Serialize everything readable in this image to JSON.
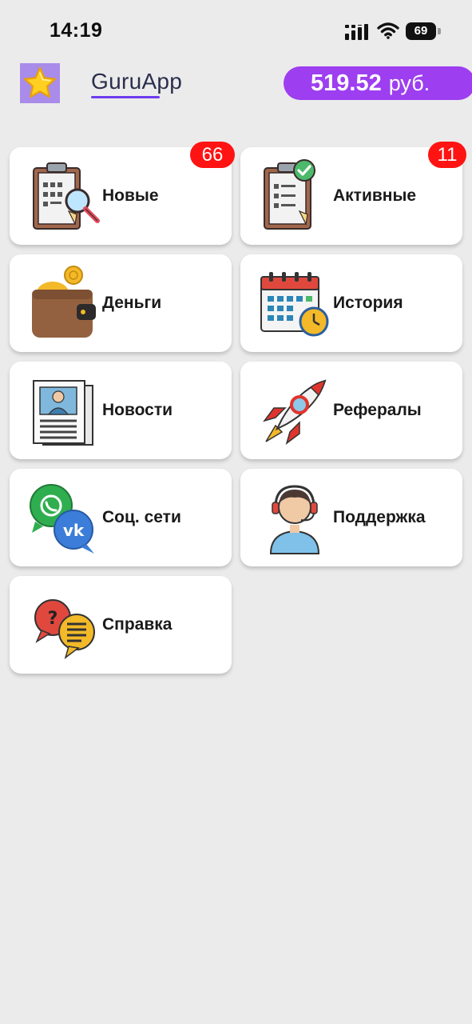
{
  "status_bar": {
    "time": "14:19",
    "battery": "69"
  },
  "header": {
    "title": "GuruApp",
    "balance_amount": "519.52",
    "balance_currency": "руб."
  },
  "colors": {
    "accent": "#9d3ef0",
    "badge": "#ff1313",
    "logo_bg": "#a98be9"
  },
  "tiles": [
    {
      "label": "Новые",
      "icon": "clipboard-search-icon",
      "badge": "66"
    },
    {
      "label": "Активные",
      "icon": "clipboard-check-icon",
      "badge": "11"
    },
    {
      "label": "Деньги",
      "icon": "wallet-icon"
    },
    {
      "label": "История",
      "icon": "calendar-clock-icon"
    },
    {
      "label": "Новости",
      "icon": "newspaper-icon"
    },
    {
      "label": "Рефералы",
      "icon": "rocket-icon"
    },
    {
      "label": "Соц. сети",
      "icon": "social-chat-icon"
    },
    {
      "label": "Поддержка",
      "icon": "support-agent-icon"
    },
    {
      "label": "Справка",
      "icon": "help-chat-icon"
    }
  ]
}
